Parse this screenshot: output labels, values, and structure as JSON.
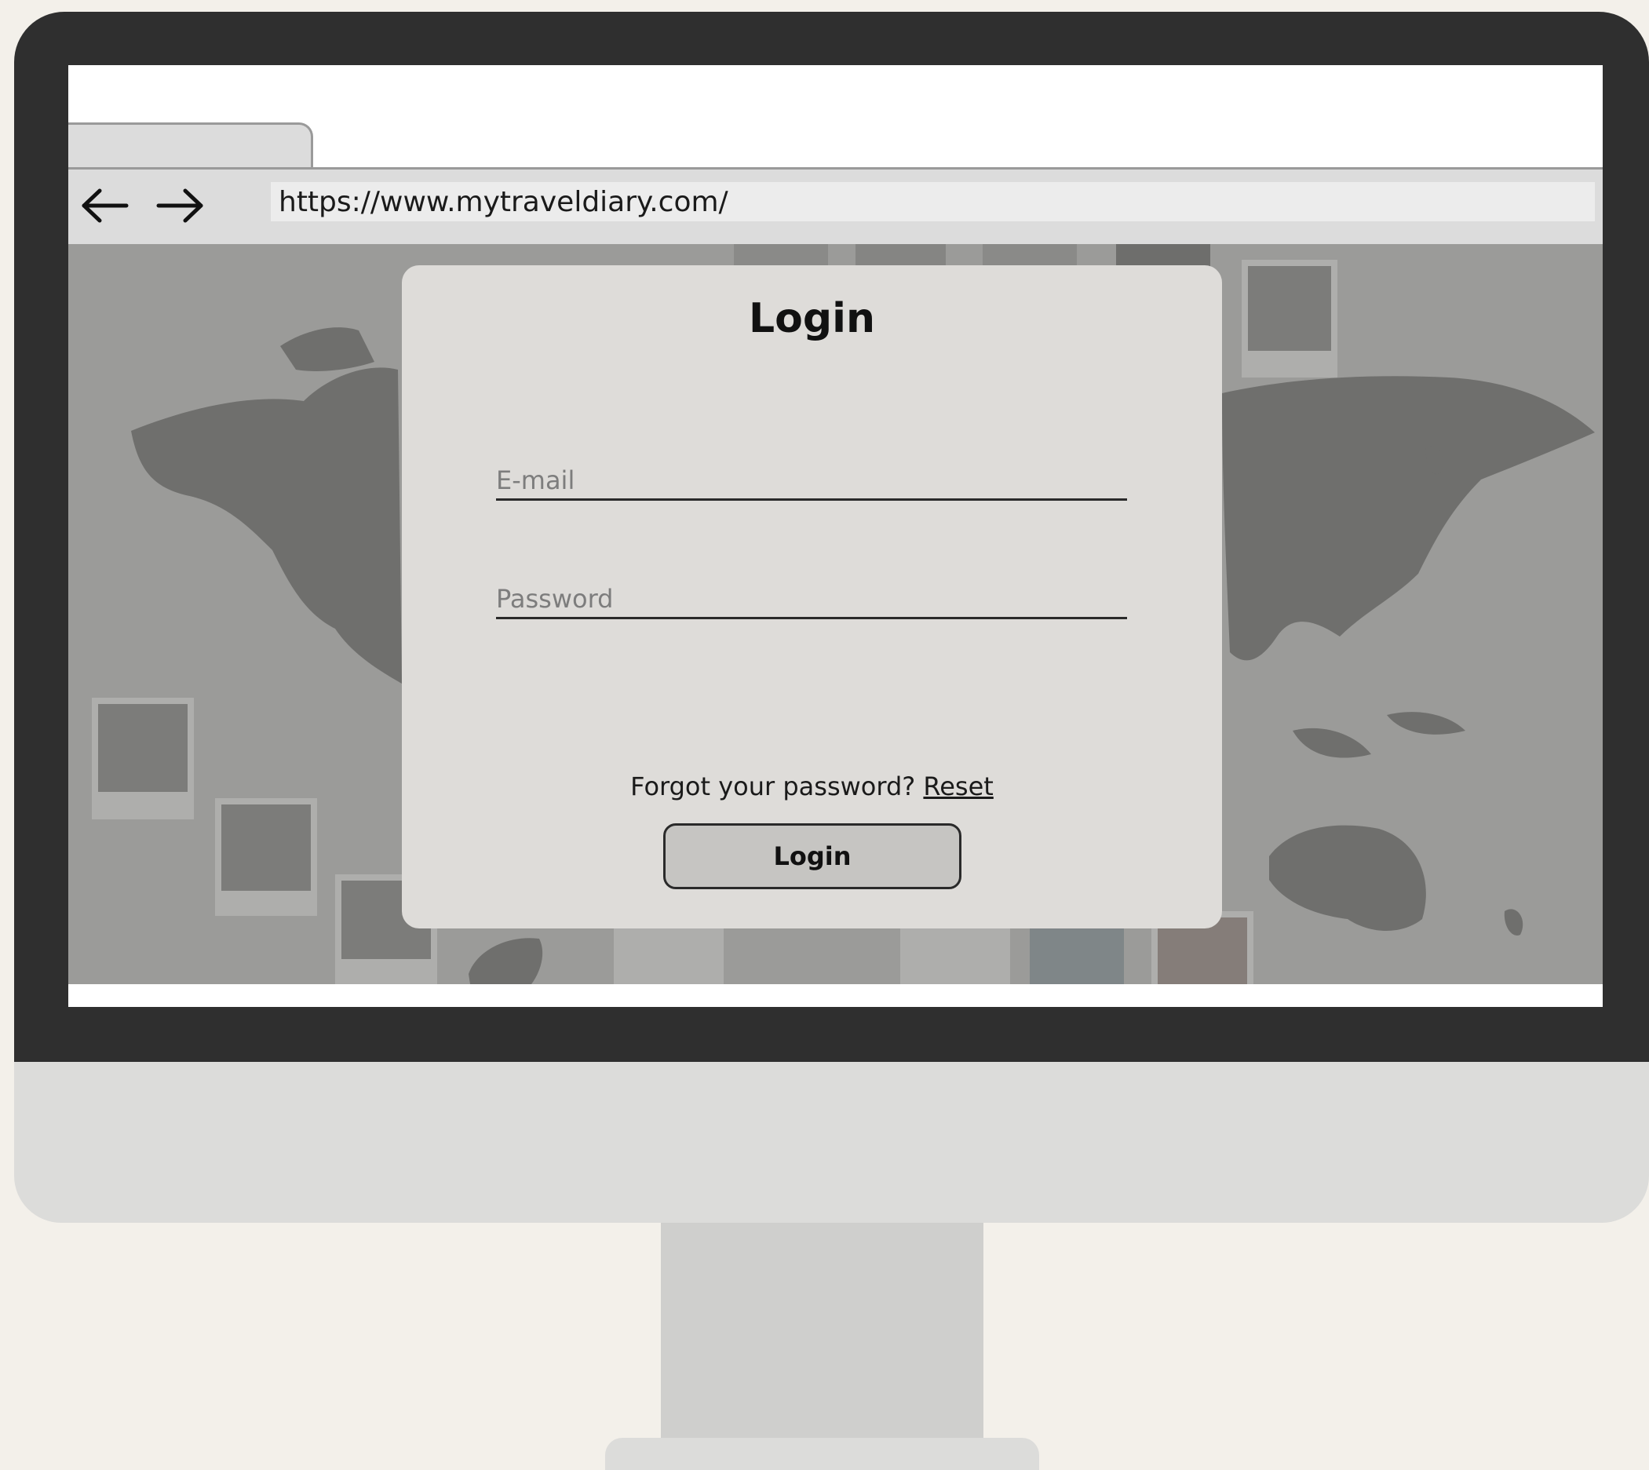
{
  "browser": {
    "url": "https://www.mytraveldiary.com/",
    "back_icon": "arrow-left-icon",
    "forward_icon": "arrow-right-icon"
  },
  "login": {
    "title": "Login",
    "email_placeholder": "E-mail",
    "email_value": "",
    "password_placeholder": "Password",
    "password_value": "",
    "forgot_text": "Forgot your password? ",
    "reset_link": "Reset",
    "submit_label": "Login"
  },
  "colors": {
    "bezel": "#2f2f2f",
    "chin": "#dcdcda",
    "page_overlay": "#9b9b99",
    "card": "#dedcd9",
    "button": "#c6c5c2",
    "background": "#f3f0ea"
  }
}
